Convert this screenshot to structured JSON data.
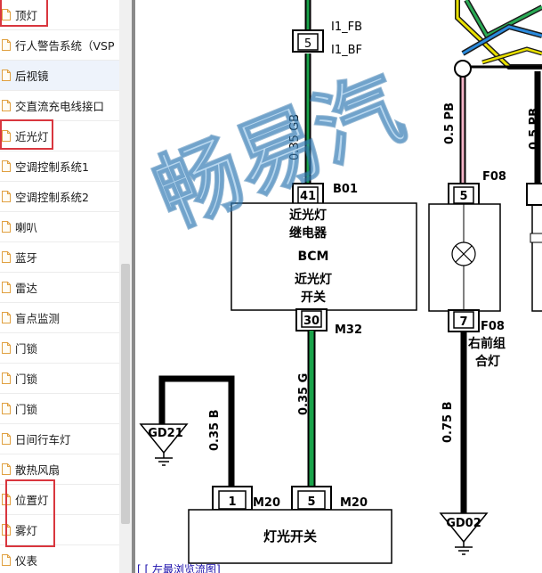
{
  "sidebar": {
    "items": [
      {
        "label": "顶灯"
      },
      {
        "label": "行人警告系统（VSP"
      },
      {
        "label": "后视镜"
      },
      {
        "label": "交直流充电线接口"
      },
      {
        "label": "近光灯"
      },
      {
        "label": "空调控制系统1"
      },
      {
        "label": "空调控制系统2"
      },
      {
        "label": "喇叭"
      },
      {
        "label": "蓝牙"
      },
      {
        "label": "雷达"
      },
      {
        "label": "盲点监测"
      },
      {
        "label": "门锁"
      },
      {
        "label": "门锁"
      },
      {
        "label": "门锁"
      },
      {
        "label": "日间行车灯"
      },
      {
        "label": "散热风扇"
      },
      {
        "label": "位置灯"
      },
      {
        "label": "雾灯"
      },
      {
        "label": "仪表"
      }
    ]
  },
  "diagram": {
    "watermark": "畅易汽",
    "wire_top_green": "0.35 GB",
    "wire_pink": "0.5 PB",
    "wire_pink_right": "0.5 PB",
    "signal_1": "I1_FB",
    "signal_2": "I1_BF",
    "pin_top": "5",
    "bcm": {
      "pin_in": "41",
      "connector_in": "B01",
      "line1": "近光灯",
      "line2": "继电器",
      "line3": "BCM",
      "line4": "近光灯",
      "line5": "开关",
      "pin_out": "30",
      "connector_out": "M32"
    },
    "fuse": {
      "pin_in": "5",
      "connector_in": "F08",
      "pin_out": "7",
      "connector_out": "F08",
      "label_1": "右前组",
      "label_2": "合灯"
    },
    "wire_green": "0.35 G",
    "wire_black_left": "0.35 B",
    "wire_black_right": "0.75 B",
    "ground_left": "GD21",
    "ground_right": "GD02",
    "switch": {
      "pin_a": "1",
      "connector_a": "M20",
      "pin_b": "5",
      "connector_b": "M20",
      "label": "灯光开关"
    },
    "link_text": "[ [ 左最浏览流图]"
  },
  "colors": {
    "wire_green": "#1aa34a",
    "wire_pink": "#f2b3c6",
    "highlight": "#d9363e",
    "watermark": "#4d9bd6"
  }
}
